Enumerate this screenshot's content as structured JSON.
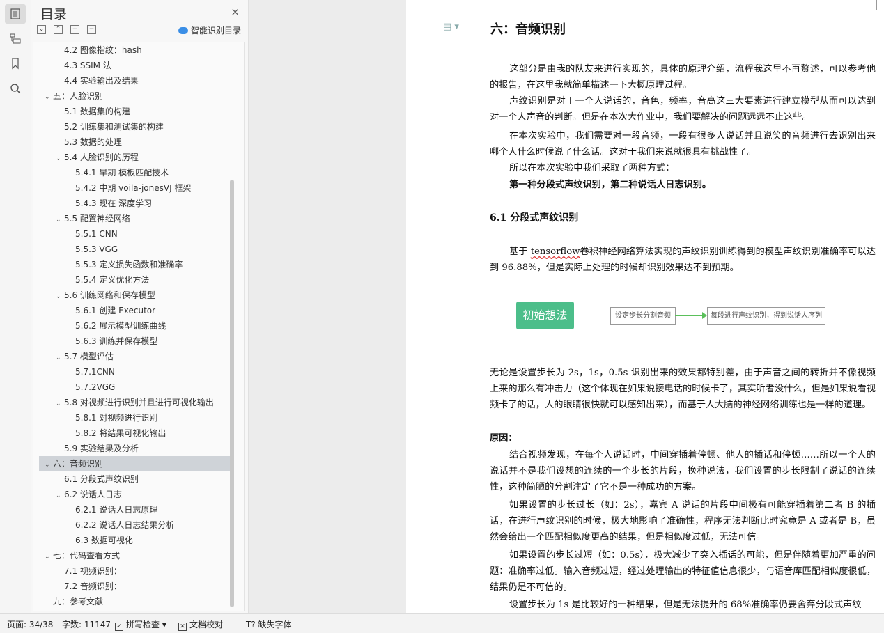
{
  "toc": {
    "title": "目录",
    "close_icon": "×",
    "smart_label": "智能识别目录",
    "items": [
      {
        "text": "4.2  图像指纹：hash",
        "level": 2
      },
      {
        "text": "4.3 SSIM 法",
        "level": 2
      },
      {
        "text": "4.4  实验输出及结果",
        "level": 2
      },
      {
        "text": "五：人脸识别",
        "level": 1,
        "chevron": "open"
      },
      {
        "text": "5.1  数据集的构建",
        "level": 2
      },
      {
        "text": "5.2  训练集和测试集的构建",
        "level": 2
      },
      {
        "text": "5.3  数据的处理",
        "level": 2
      },
      {
        "text": "5.4  人脸识别的历程",
        "level": 2,
        "chevron": "open"
      },
      {
        "text": "5.4.1  早期  模板匹配技术",
        "level": 3
      },
      {
        "text": "5.4.2  中期  voila-jonesVJ 框架",
        "level": 3
      },
      {
        "text": "5.4.3  现在  深度学习",
        "level": 3
      },
      {
        "text": "5.5  配置神经网络",
        "level": 2,
        "chevron": "open"
      },
      {
        "text": "5.5.1 CNN",
        "level": 3
      },
      {
        "text": "5.5.3 VGG",
        "level": 3
      },
      {
        "text": "5.5.3  定义损失函数和准确率",
        "level": 3
      },
      {
        "text": "5.5.4  定义优化方法",
        "level": 3
      },
      {
        "text": "5.6  训练网络和保存模型",
        "level": 2,
        "chevron": "open"
      },
      {
        "text": "5.6.1 创建 Executor",
        "level": 3
      },
      {
        "text": "5.6.2 展示模型训练曲线",
        "level": 3
      },
      {
        "text": "5.6.3 训练并保存模型",
        "level": 3
      },
      {
        "text": "5.7  模型评估",
        "level": 2,
        "chevron": "open"
      },
      {
        "text": "5.7.1CNN",
        "level": 3
      },
      {
        "text": "5.7.2VGG",
        "level": 3
      },
      {
        "text": "5.8  对视频进行识别并且进行可视化输出",
        "level": 2,
        "chevron": "open"
      },
      {
        "text": "5.8.1  对视频进行识别",
        "level": 3
      },
      {
        "text": "5.8.2  将结果可视化输出",
        "level": 3
      },
      {
        "text": "5.9  实验结果及分析",
        "level": 2
      },
      {
        "text": "六：音频识别",
        "level": 1,
        "chevron": "open",
        "selected": true
      },
      {
        "text": "6.1  分段式声纹识别",
        "level": 2
      },
      {
        "text": "6.2  说话人日志",
        "level": 2,
        "chevron": "open"
      },
      {
        "text": "6.2.1  说话人日志原理",
        "level": 3
      },
      {
        "text": "6.2.2  说话人日志结果分析",
        "level": 3
      },
      {
        "text": "6.3  数据可视化",
        "level": 3
      },
      {
        "text": "七：代码查看方式",
        "level": 1,
        "chevron": "open"
      },
      {
        "text": "7.1  视频识别：",
        "level": 2
      },
      {
        "text": "7.2  音频识别：",
        "level": 2
      },
      {
        "text": "九：参考文献",
        "level": 1
      }
    ]
  },
  "doc": {
    "h1": "六：音频识别",
    "p1": "这部分是由我的队友来进行实现的，具体的原理介绍，流程我这里不再赘述，可以参考他的报告，在这里我就简单描述一下大概原理过程。",
    "p2": "声纹识别是对于一个人说话的，音色，频率，音高这三大要素进行建立模型从而可以达到对一个人声音的判断。但是在本次大作业中，我们要解决的问题远远不止这些。",
    "p3": "在本次实验中，我们需要对一段音频，一段有很多人说话并且说笑的音频进行去识别出来哪个人什么时候说了什么话。这对于我们来说就很具有挑战性了。",
    "p4": "所以在本次实验中我们采取了两种方式：",
    "p5": "第一种分段式声纹识别，第二种说话人日志识别。",
    "h2": "6.1 分段式声纹识别",
    "p6a": "基于 ",
    "p6word": "tensorflow",
    "p6b": "卷积神经网络算法实现的声纹识别训练得到的模型声纹识别准确率可以达到 96.88%，但是实际上处理的时候却识别效果达不到预期。",
    "flow": {
      "a": "初始想法",
      "b": "设定步长分割音频",
      "c": "每段进行声纹识别，得到说话人序列"
    },
    "p7": "无论是设置步长为 2s，1s，0.5s 识别出来的效果都特别差，由于声音之间的转折并不像视频上来的那么有冲击力（这个体现在如果说接电话的时候卡了，其实听者没什么，但是如果说看视频卡了的话，人的眼睛很快就可以感知出来），而基于人大脑的神经网络训练也是一样的道理。",
    "p8": "原因：",
    "p9": "结合视频发现，在每个人说话时，中间穿插着停顿、他人的插话和停顿……所以一个人的说话并不是我们设想的连续的一个步长的片段，换种说法，我们设置的步长限制了说话的连续性，这种简陋的分割注定了它不是一种成功的方案。",
    "p10": "如果设置的步长过长（如：2s），嘉宾 A 说话的片段中间极有可能穿插着第二者 B 的插话，在进行声纹识别的时候，极大地影响了准确性，程序无法判断此时究竟是 A 或者是 B，虽然会给出一个匹配相似度更高的结果，但是相似度过低，无法可信。",
    "p11": "如果设置的步长过短（如：0.5s），极大减少了突入插话的可能，但是伴随着更加严重的问题：准确率过低。输入音频过短，经过处理输出的特征值信息很少，与语音库匹配相似度很低，结果仍是不可信的。",
    "p12": "设置步长为 1s 是比较好的一种结果，但是无法提升的 68%准确率仍要舍弃分段式声纹"
  },
  "status": {
    "page": "页面: 34/38",
    "words": "字数: 11147",
    "spell": "拼写检查",
    "proof": "文档校对",
    "font": "缺失字体"
  }
}
